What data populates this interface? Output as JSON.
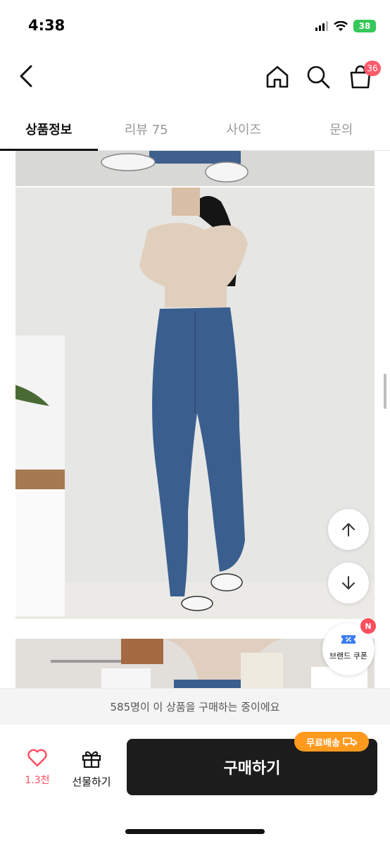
{
  "status_bar": {
    "time": "4:38",
    "battery": "38"
  },
  "nav": {
    "cart_count": "36"
  },
  "tabs": [
    {
      "label": "상품정보"
    },
    {
      "label": "리뷰 75"
    },
    {
      "label": "사이즈"
    },
    {
      "label": "문의"
    }
  ],
  "coupon": {
    "label": "브랜드 쿠폰",
    "badge": "N"
  },
  "info_strip": {
    "text": "585명이 이 상품을 구매하는 중이에요"
  },
  "action_bar": {
    "like_count": "1.3천",
    "gift_label": "선물하기",
    "buy_label": "구매하기",
    "free_shipping_label": "무료배송"
  },
  "colors": {
    "accent": "#ff4d5e",
    "buy_button": "#1c1c1c",
    "free_shipping": "#ff9a1f",
    "battery": "#34c759"
  },
  "icons": [
    "back-arrow-icon",
    "home-icon",
    "search-icon",
    "cart-icon",
    "arrow-up-icon",
    "arrow-down-icon",
    "heart-icon",
    "gift-icon",
    "coupon-icon",
    "truck-icon"
  ]
}
